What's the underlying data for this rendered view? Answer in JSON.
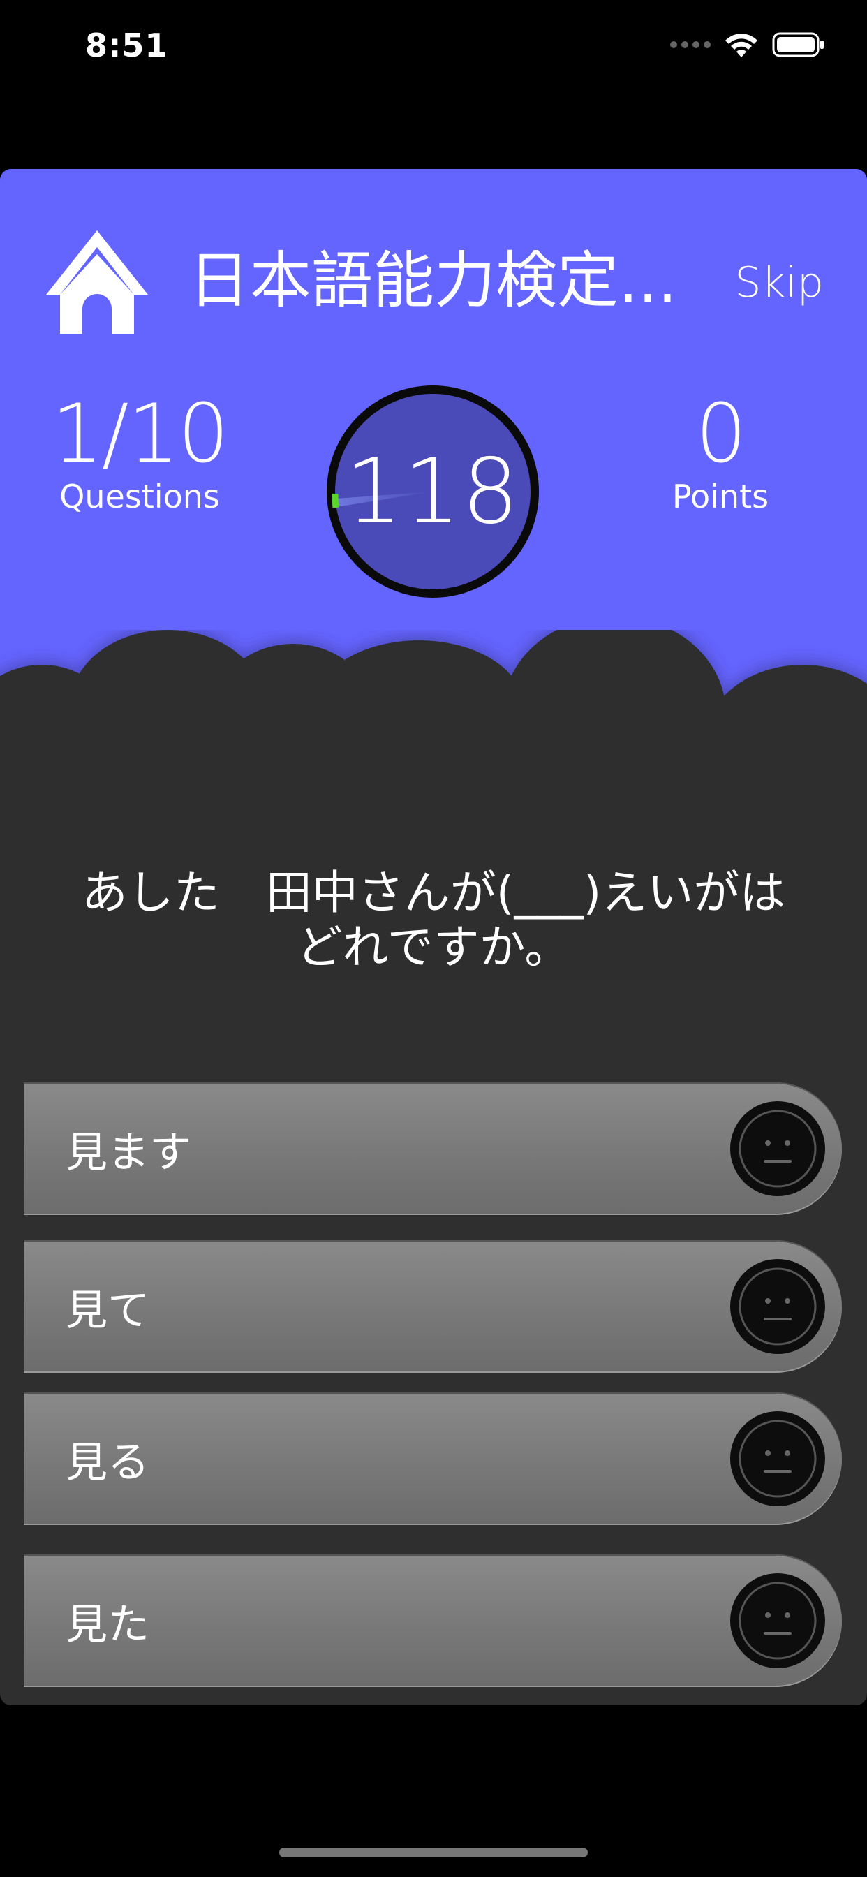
{
  "status_bar": {
    "time": "8:51"
  },
  "header": {
    "title": "日本語能力検定...",
    "skip_label": "Skip"
  },
  "stats": {
    "questions_value": "1/10",
    "questions_label": "Questions",
    "points_value": "0",
    "points_label": "Points"
  },
  "timer": {
    "value": "118"
  },
  "question": {
    "text": "あした　田中さんが(___)えいがは どれですか。"
  },
  "answers": [
    {
      "label": "見ます"
    },
    {
      "label": "見て"
    },
    {
      "label": "見る"
    },
    {
      "label": "見た"
    }
  ],
  "colors": {
    "primary": "#6464ff",
    "dark_background": "#2f2f2f",
    "timer_progress": "#5ad62a"
  },
  "icons": {
    "home": "home-icon",
    "answer_state": "neutral-face-icon",
    "wifi": "wifi-icon",
    "battery": "battery-icon"
  }
}
